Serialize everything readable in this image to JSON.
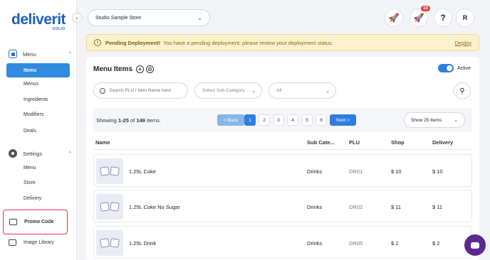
{
  "sidebar": {
    "logo": "deliverit",
    "logo_sub": "COLIO",
    "menu_section": "Menu",
    "menu_items": [
      "Items",
      "Menus",
      "Ingredients",
      "Modifiers",
      "Deals"
    ],
    "settings_section": "Settings",
    "settings_items": [
      "Menu",
      "Store",
      "Delivery"
    ],
    "promo_code": "Promo Code",
    "image_library": "Image Library"
  },
  "header": {
    "store": "Studio Sample Store",
    "notification_count": "10",
    "help": "?",
    "avatar": "R"
  },
  "banner": {
    "title": "Pending Deployment!",
    "message": "You have a pending deployment; please review your deployment status.",
    "link": "Deploy"
  },
  "main": {
    "title": "Menu Items",
    "active_label": "Active",
    "search_placeholder": "Search PLU / Item Name here",
    "subcategory_placeholder": "Select Sub Category",
    "filter_all": "All",
    "showing_prefix": "Showing ",
    "showing_range": "1-25",
    "showing_of": " of ",
    "showing_total": "149",
    "showing_suffix": " items.",
    "back": "< Back",
    "pages": [
      "1",
      "2",
      "3",
      "4",
      "5",
      "6"
    ],
    "next": "Next >",
    "page_size": "Show 25 Items"
  },
  "table": {
    "columns": [
      "Name",
      "Sub Cate...",
      "PLU",
      "Shop",
      "Delivery"
    ],
    "rows": [
      {
        "name": "1.25L Coke",
        "sub_category": "Drinks",
        "plu": "DR01",
        "shop": "$ 10",
        "delivery": "$ 10"
      },
      {
        "name": "1.25L Coke No Sugar",
        "sub_category": "Drinks",
        "plu": "DR02",
        "shop": "$ 11",
        "delivery": "$ 11"
      },
      {
        "name": "1.25L Drink",
        "sub_category": "Drinks",
        "plu": "DR05",
        "shop": "$ 2",
        "delivery": "$ 2"
      }
    ]
  },
  "icons": {
    "menu": "menu-book-icon",
    "settings": "gear-icon",
    "rocket": "rocket-icon",
    "filter": "filter-icon",
    "chat": "chat-icon"
  },
  "colors": {
    "brand": "#1f5fbf",
    "accent": "#2f7de1",
    "highlight_border": "#e23b3b",
    "banner_bg": "#fbf1cf"
  }
}
